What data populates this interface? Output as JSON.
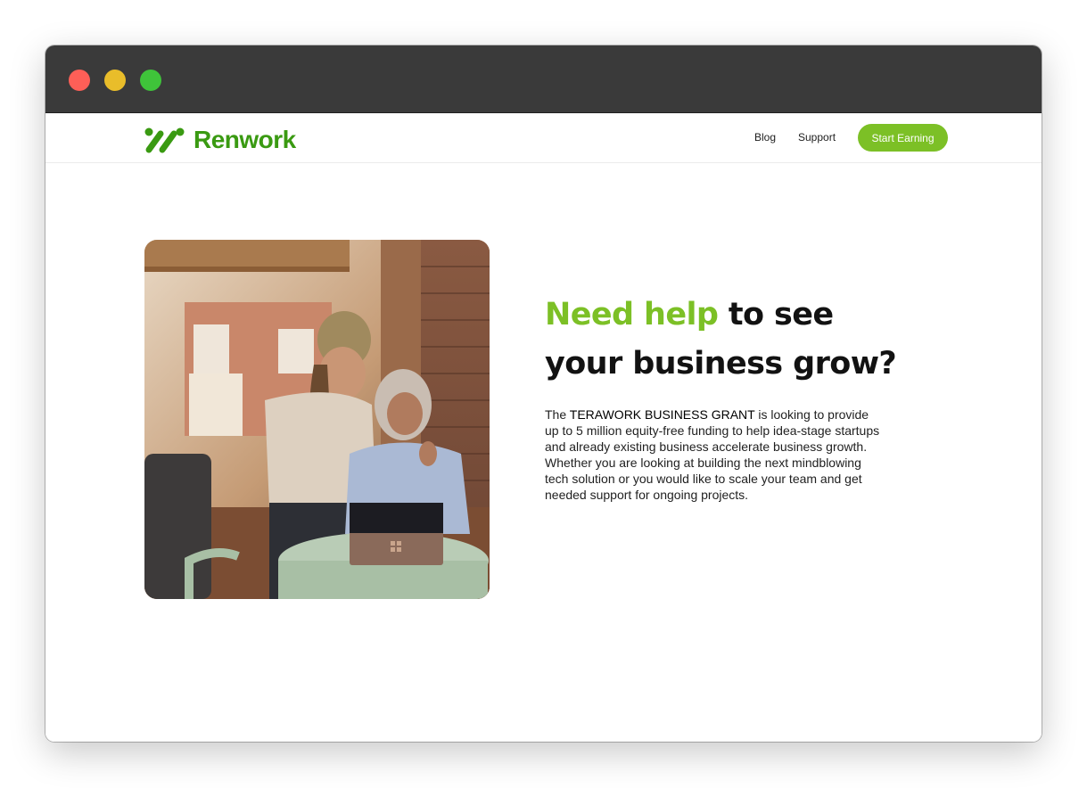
{
  "window": {
    "controls": [
      "close-button",
      "minimize-button",
      "maximize-button"
    ]
  },
  "navbar": {
    "brand": "Renwork",
    "links": [
      {
        "label": "Blog"
      },
      {
        "label": "Support"
      }
    ],
    "cta_label": "Start Earning"
  },
  "hero": {
    "headline_accent": "Need help",
    "headline_rest_1": " to see",
    "headline_rest_2": "your business grow?",
    "body_intro": "The ",
    "body_emphasis": "TERAWORK BUSINESS GRANT",
    "body_rest": " is looking to provide up to 5 million equity-free funding to help idea-stage startups and already existing business accelerate business growth. Whether you are looking at building the next mindblowing tech solution or you would like to scale your team and get needed support for ongoing projects."
  },
  "colors": {
    "brand_green": "#3a9a12",
    "accent_green": "#7cc026",
    "titlebar": "#3a3a3a"
  },
  "icons": {
    "brand_logo": "renwork-logo-icon",
    "photo": "two-women-laptop-photo"
  }
}
